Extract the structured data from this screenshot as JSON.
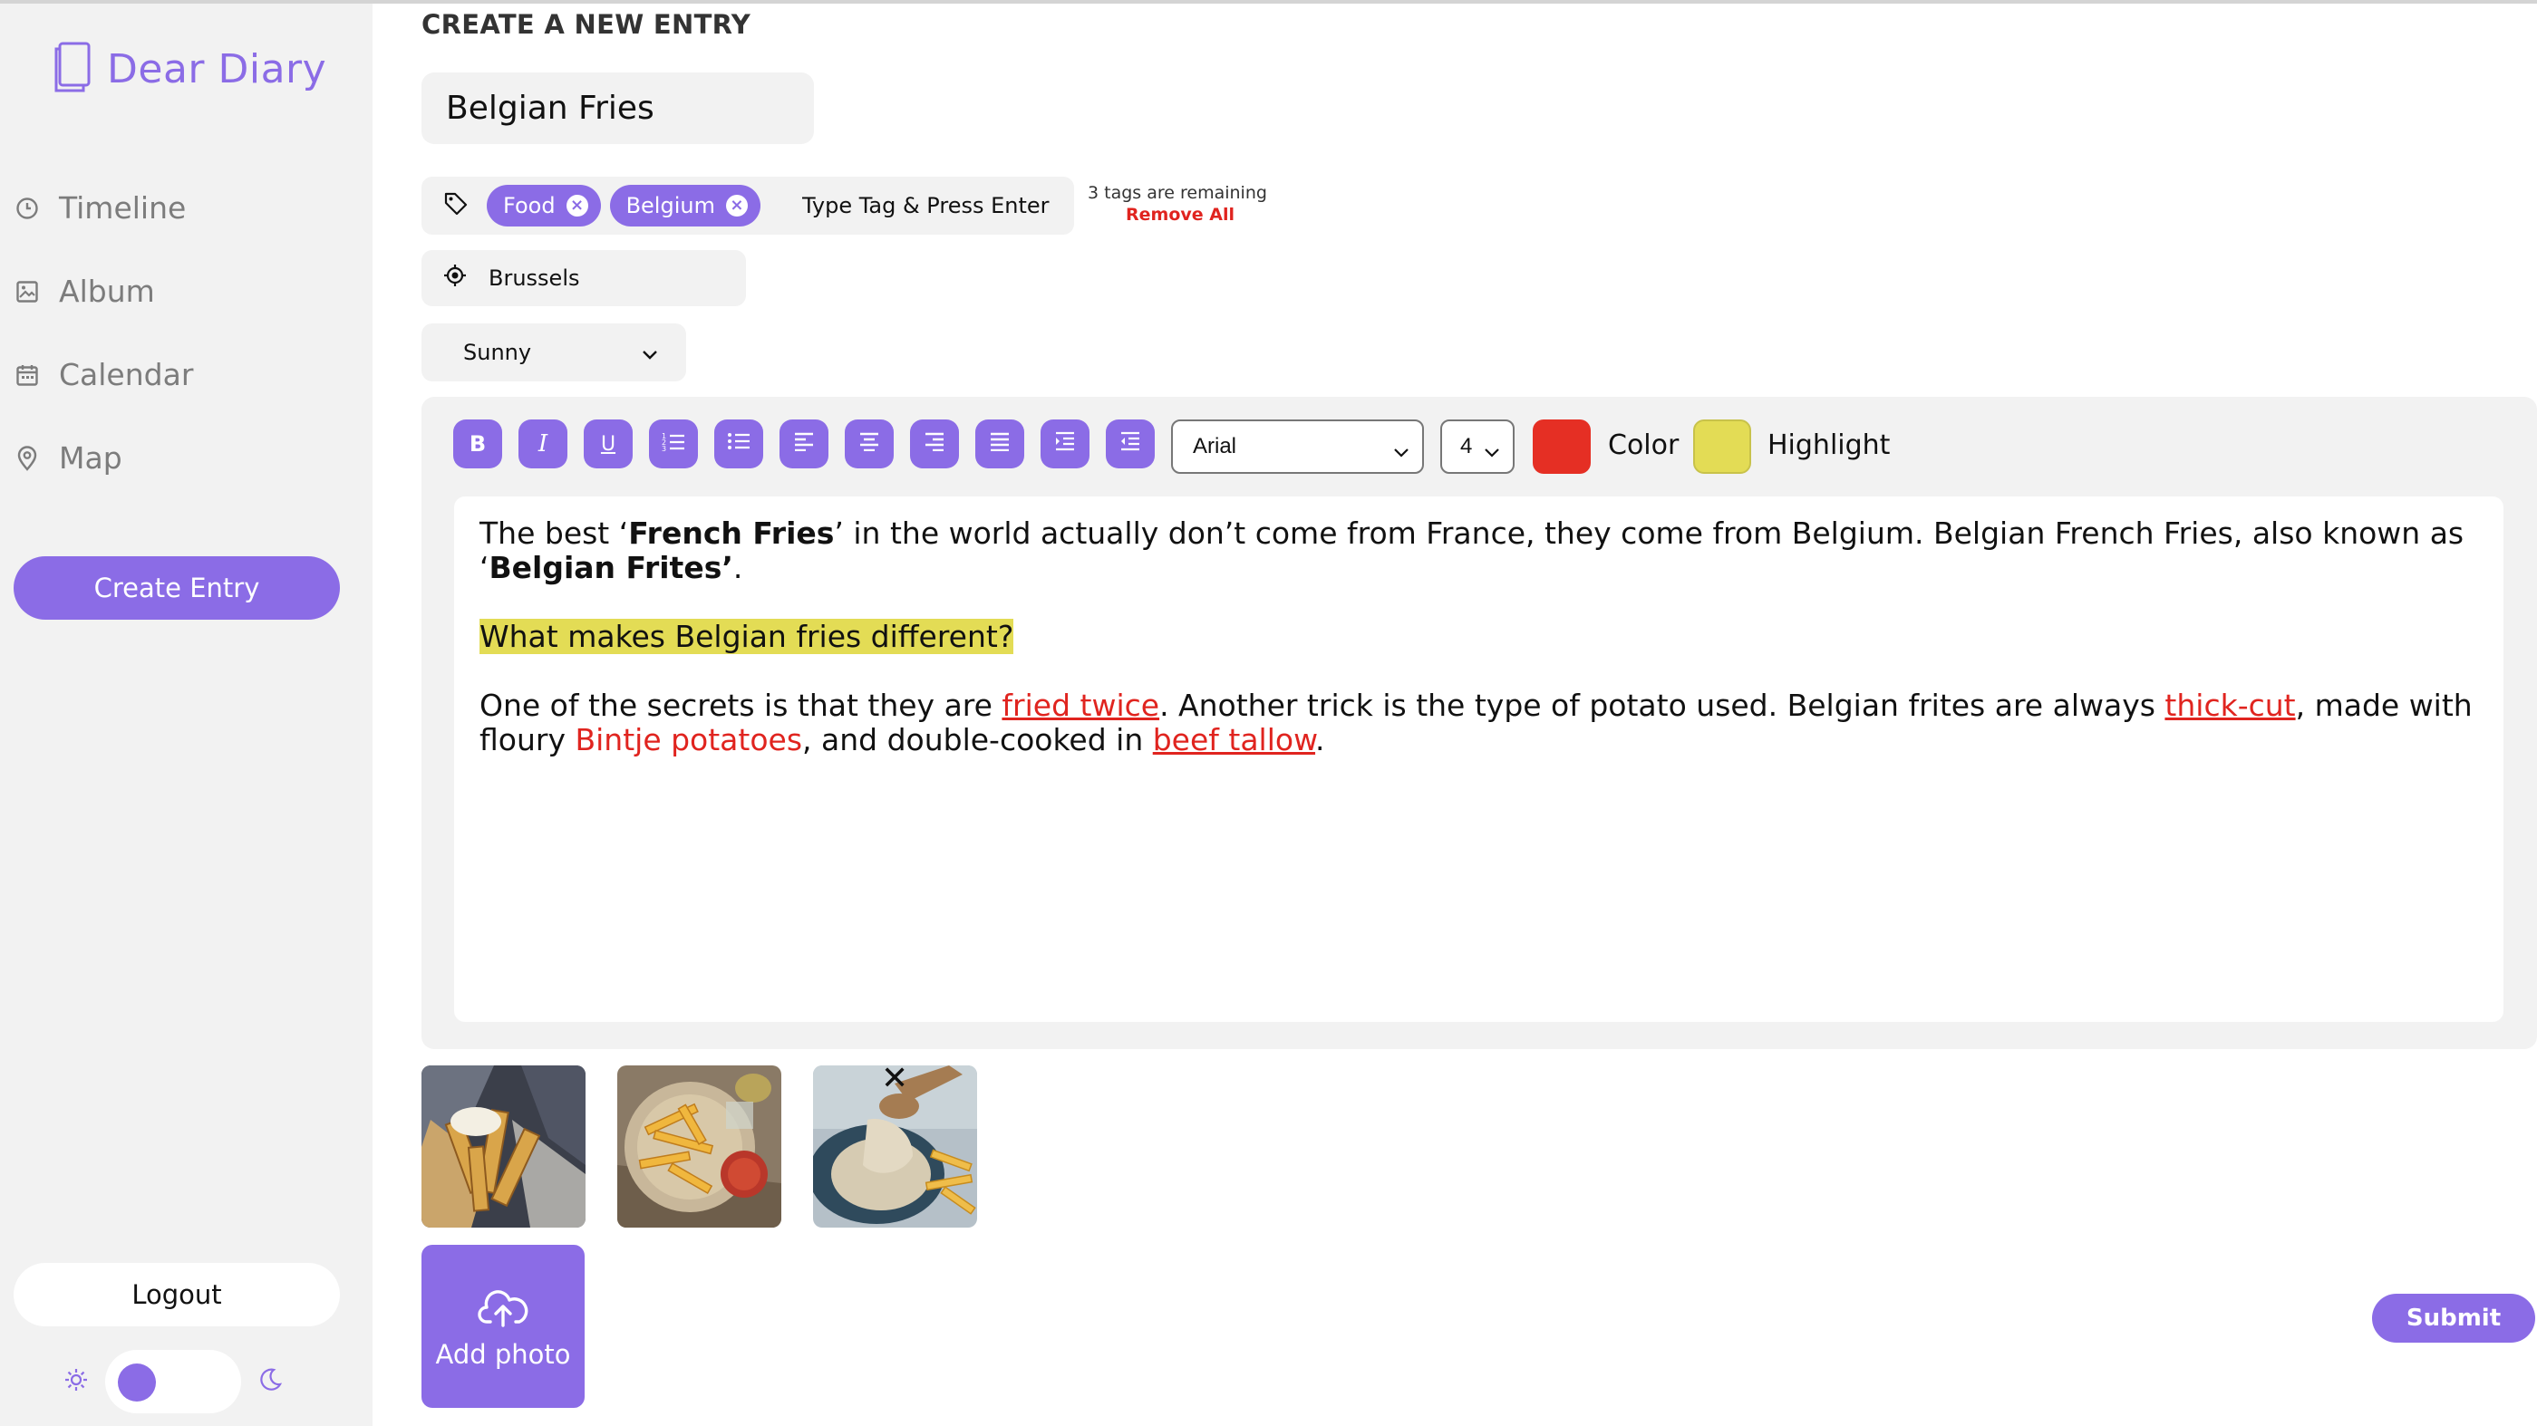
{
  "app": {
    "brand": "Dear Diary"
  },
  "sidebar": {
    "items": [
      {
        "label": "Timeline",
        "icon": "clock-icon"
      },
      {
        "label": "Album",
        "icon": "image-icon"
      },
      {
        "label": "Calendar",
        "icon": "calendar-icon"
      },
      {
        "label": "Map",
        "icon": "map-pin-icon"
      }
    ],
    "create_label": "Create Entry",
    "logout_label": "Logout",
    "theme": {
      "light_icon": "sun-icon",
      "dark_icon": "moon-icon",
      "mode": "light"
    }
  },
  "form": {
    "heading": "CREATE A NEW ENTRY",
    "title_value": "Belgian Fries",
    "tags": [
      "Food",
      "Belgium"
    ],
    "tag_placeholder": "Type Tag & Press Enter",
    "tags_remaining": "3 tags are remaining",
    "remove_all": "Remove All",
    "location": "Brussels",
    "weather": "Sunny"
  },
  "editor": {
    "toolbar_buttons": [
      "B",
      "I",
      "U",
      "ordered-list-icon",
      "unordered-list-icon",
      "align-left-icon",
      "align-center-icon",
      "align-right-icon",
      "align-justify-icon",
      "indent-icon",
      "outdent-icon"
    ],
    "font": "Arial",
    "size": "4",
    "color_label": "Color",
    "color_value": "#e52f24",
    "highlight_label": "Highlight",
    "highlight_value": "#e3dc55",
    "p1": {
      "a": "The best ‘",
      "b": "French Fries",
      "c": "’ in the world actually don’t come from France, they come from Belgium. Belgian French Fries, also known as ‘",
      "d": "Belgian Frites’",
      "e": "."
    },
    "p2": "What makes Belgian fries different?",
    "p3": {
      "a": "One of the secrets is that they are ",
      "link1": "fried twice",
      "b": ". Another trick is the type of potato used. Belgian frites are always ",
      "link2": "thick-cut",
      "c": ", made with floury ",
      "red1": "Bintje potatoes",
      "d": ", and double-cooked in ",
      "link3": "beef tallow",
      "e": "."
    }
  },
  "photos": {
    "items": [
      "fries-with-mayo-photo",
      "fries-with-ketchup-photo",
      "fries-with-sauce-photo"
    ],
    "add_label": "Add photo"
  },
  "submit_label": "Submit"
}
